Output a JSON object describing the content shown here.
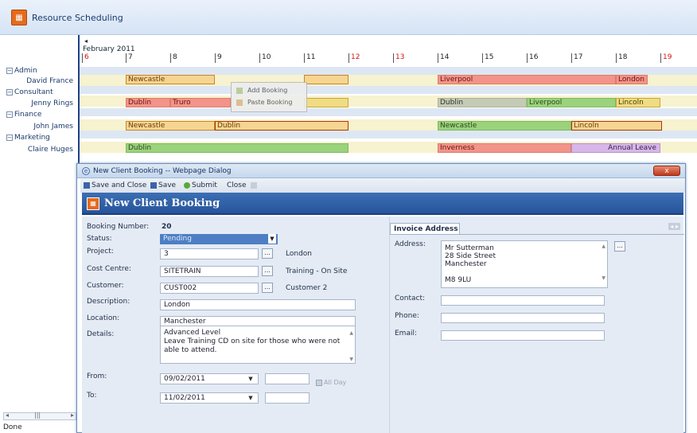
{
  "app": {
    "title": "Resource Scheduling",
    "icon": "calendar-icon"
  },
  "timeline": {
    "month": "February 2011",
    "back_arrow": "◂",
    "days": [
      {
        "label": "6",
        "weekend": true
      },
      {
        "label": "7",
        "weekend": false
      },
      {
        "label": "8",
        "weekend": false
      },
      {
        "label": "9",
        "weekend": false
      },
      {
        "label": "10",
        "weekend": false
      },
      {
        "label": "11",
        "weekend": false
      },
      {
        "label": "12",
        "weekend": true
      },
      {
        "label": "13",
        "weekend": true
      },
      {
        "label": "14",
        "weekend": false
      },
      {
        "label": "15",
        "weekend": false
      },
      {
        "label": "16",
        "weekend": false
      },
      {
        "label": "17",
        "weekend": false
      },
      {
        "label": "18",
        "weekend": false
      },
      {
        "label": "19",
        "weekend": true
      }
    ]
  },
  "resources": {
    "groups": [
      {
        "expander": "−",
        "name": "Admin"
      },
      {
        "expander": "−",
        "name": "Consultant"
      },
      {
        "expander": "−",
        "name": "Finance"
      },
      {
        "expander": "−",
        "name": "Marketing"
      }
    ],
    "people": [
      "David France",
      "Jenny Rings",
      "John James",
      "Claire Huges"
    ]
  },
  "bookings": [
    {
      "label": "Newcastle",
      "color": "orange"
    },
    {
      "label": "",
      "color": "orange"
    },
    {
      "label": "Liverpool",
      "color": "red"
    },
    {
      "label": "London",
      "color": "red"
    },
    {
      "label": "Dublin",
      "color": "red"
    },
    {
      "label": "Truro",
      "color": "red"
    },
    {
      "label": "",
      "color": "orange"
    },
    {
      "label": "Dublin",
      "color": "grey"
    },
    {
      "label": "Liverpool",
      "color": "green"
    },
    {
      "label": "Lincoln",
      "color": "yellow"
    },
    {
      "label": "Newcastle",
      "color": "orange"
    },
    {
      "label": "Dublin",
      "color": "orange"
    },
    {
      "label": "Newcastle",
      "color": "green"
    },
    {
      "label": "Lincoln",
      "color": "green"
    },
    {
      "label": "Dublin",
      "color": "green"
    },
    {
      "label": "Inverness",
      "color": "red"
    },
    {
      "label": "Annual Leave",
      "color": "violet"
    }
  ],
  "context_menu": {
    "items": [
      "Add Booking",
      "Paste Booking"
    ]
  },
  "status_bar": {
    "text": "Done",
    "scroll": "|||"
  },
  "dialog": {
    "title": "New Client Booking -- Webpage Dialog",
    "close": "x",
    "toolbar": {
      "save_close": "Save and Close",
      "save": "Save",
      "submit": "Submit",
      "close": "Close"
    },
    "header_title": "New Client Booking",
    "form": {
      "booking_number_label": "Booking Number:",
      "booking_number": "20",
      "status_label": "Status:",
      "status_value": "Pending",
      "project_label": "Project:",
      "project_value": "3",
      "project_name": "London",
      "cost_centre_label": "Cost Centre:",
      "cost_centre_value": "SITETRAIN",
      "cost_centre_name": "Training - On Site",
      "customer_label": "Customer:",
      "customer_value": "CUST002",
      "customer_name": "Customer 2",
      "description_label": "Description:",
      "description_value": "London",
      "location_label": "Location:",
      "location_value": "Manchester",
      "details_label": "Details:",
      "details_line1": "Advanced Level",
      "details_line2": "Leave Training CD on site for those who were not",
      "details_line3": "able to attend.",
      "from_label": "From:",
      "from_value": "09/02/2011",
      "to_label": "To:",
      "to_value": "11/02/2011",
      "all_day_label": "All Day",
      "lookup_label": "..."
    },
    "invoice": {
      "tab_label": "Invoice Address",
      "nav": "◂ ▸",
      "address_label": "Address:",
      "address_line1": "Mr Sutterman",
      "address_line2": "28 Side Street",
      "address_line3": "Manchester",
      "address_line4": "M8 9LU",
      "contact_label": "Contact:",
      "phone_label": "Phone:",
      "email_label": "Email:"
    }
  }
}
